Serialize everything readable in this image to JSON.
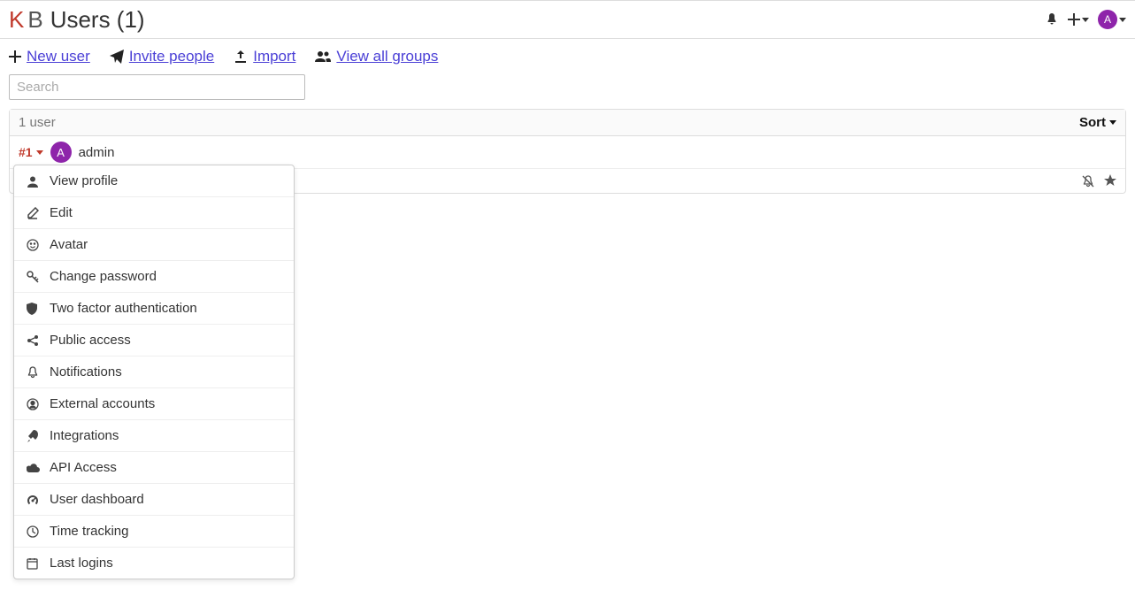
{
  "logo": {
    "k": "K",
    "b": "B"
  },
  "page_title": "Users (1)",
  "actions": {
    "new_user": "New user",
    "invite": "Invite people",
    "import": "Import",
    "view_groups": "View all groups"
  },
  "search": {
    "placeholder": "Search",
    "value": ""
  },
  "table": {
    "count_label": "1 user",
    "sort_label": "Sort"
  },
  "user": {
    "id_label": "#1",
    "avatar_letter": "A",
    "name": "admin"
  },
  "top_avatar_letter": "A",
  "menu": {
    "items": [
      {
        "label": "View profile",
        "icon": "user"
      },
      {
        "label": "Edit",
        "icon": "edit"
      },
      {
        "label": "Avatar",
        "icon": "smile"
      },
      {
        "label": "Change password",
        "icon": "key"
      },
      {
        "label": "Two factor authentication",
        "icon": "shield"
      },
      {
        "label": "Public access",
        "icon": "share"
      },
      {
        "label": "Notifications",
        "icon": "bell"
      },
      {
        "label": "External accounts",
        "icon": "usercircle"
      },
      {
        "label": "Integrations",
        "icon": "rocket"
      },
      {
        "label": "API Access",
        "icon": "cloud"
      },
      {
        "label": "User dashboard",
        "icon": "gauge"
      },
      {
        "label": "Time tracking",
        "icon": "clock"
      },
      {
        "label": "Last logins",
        "icon": "calendar"
      }
    ]
  }
}
